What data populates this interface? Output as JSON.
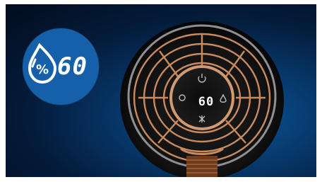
{
  "badge": {
    "icon": "humidity-drop-percent-icon",
    "value": "60",
    "color": "#1560a8"
  },
  "device": {
    "display": {
      "value": "60",
      "icons": [
        "power-icon",
        "fan-icon",
        "humidity-icon",
        "mode-icon"
      ]
    },
    "grille_color": "#c98a5e"
  }
}
